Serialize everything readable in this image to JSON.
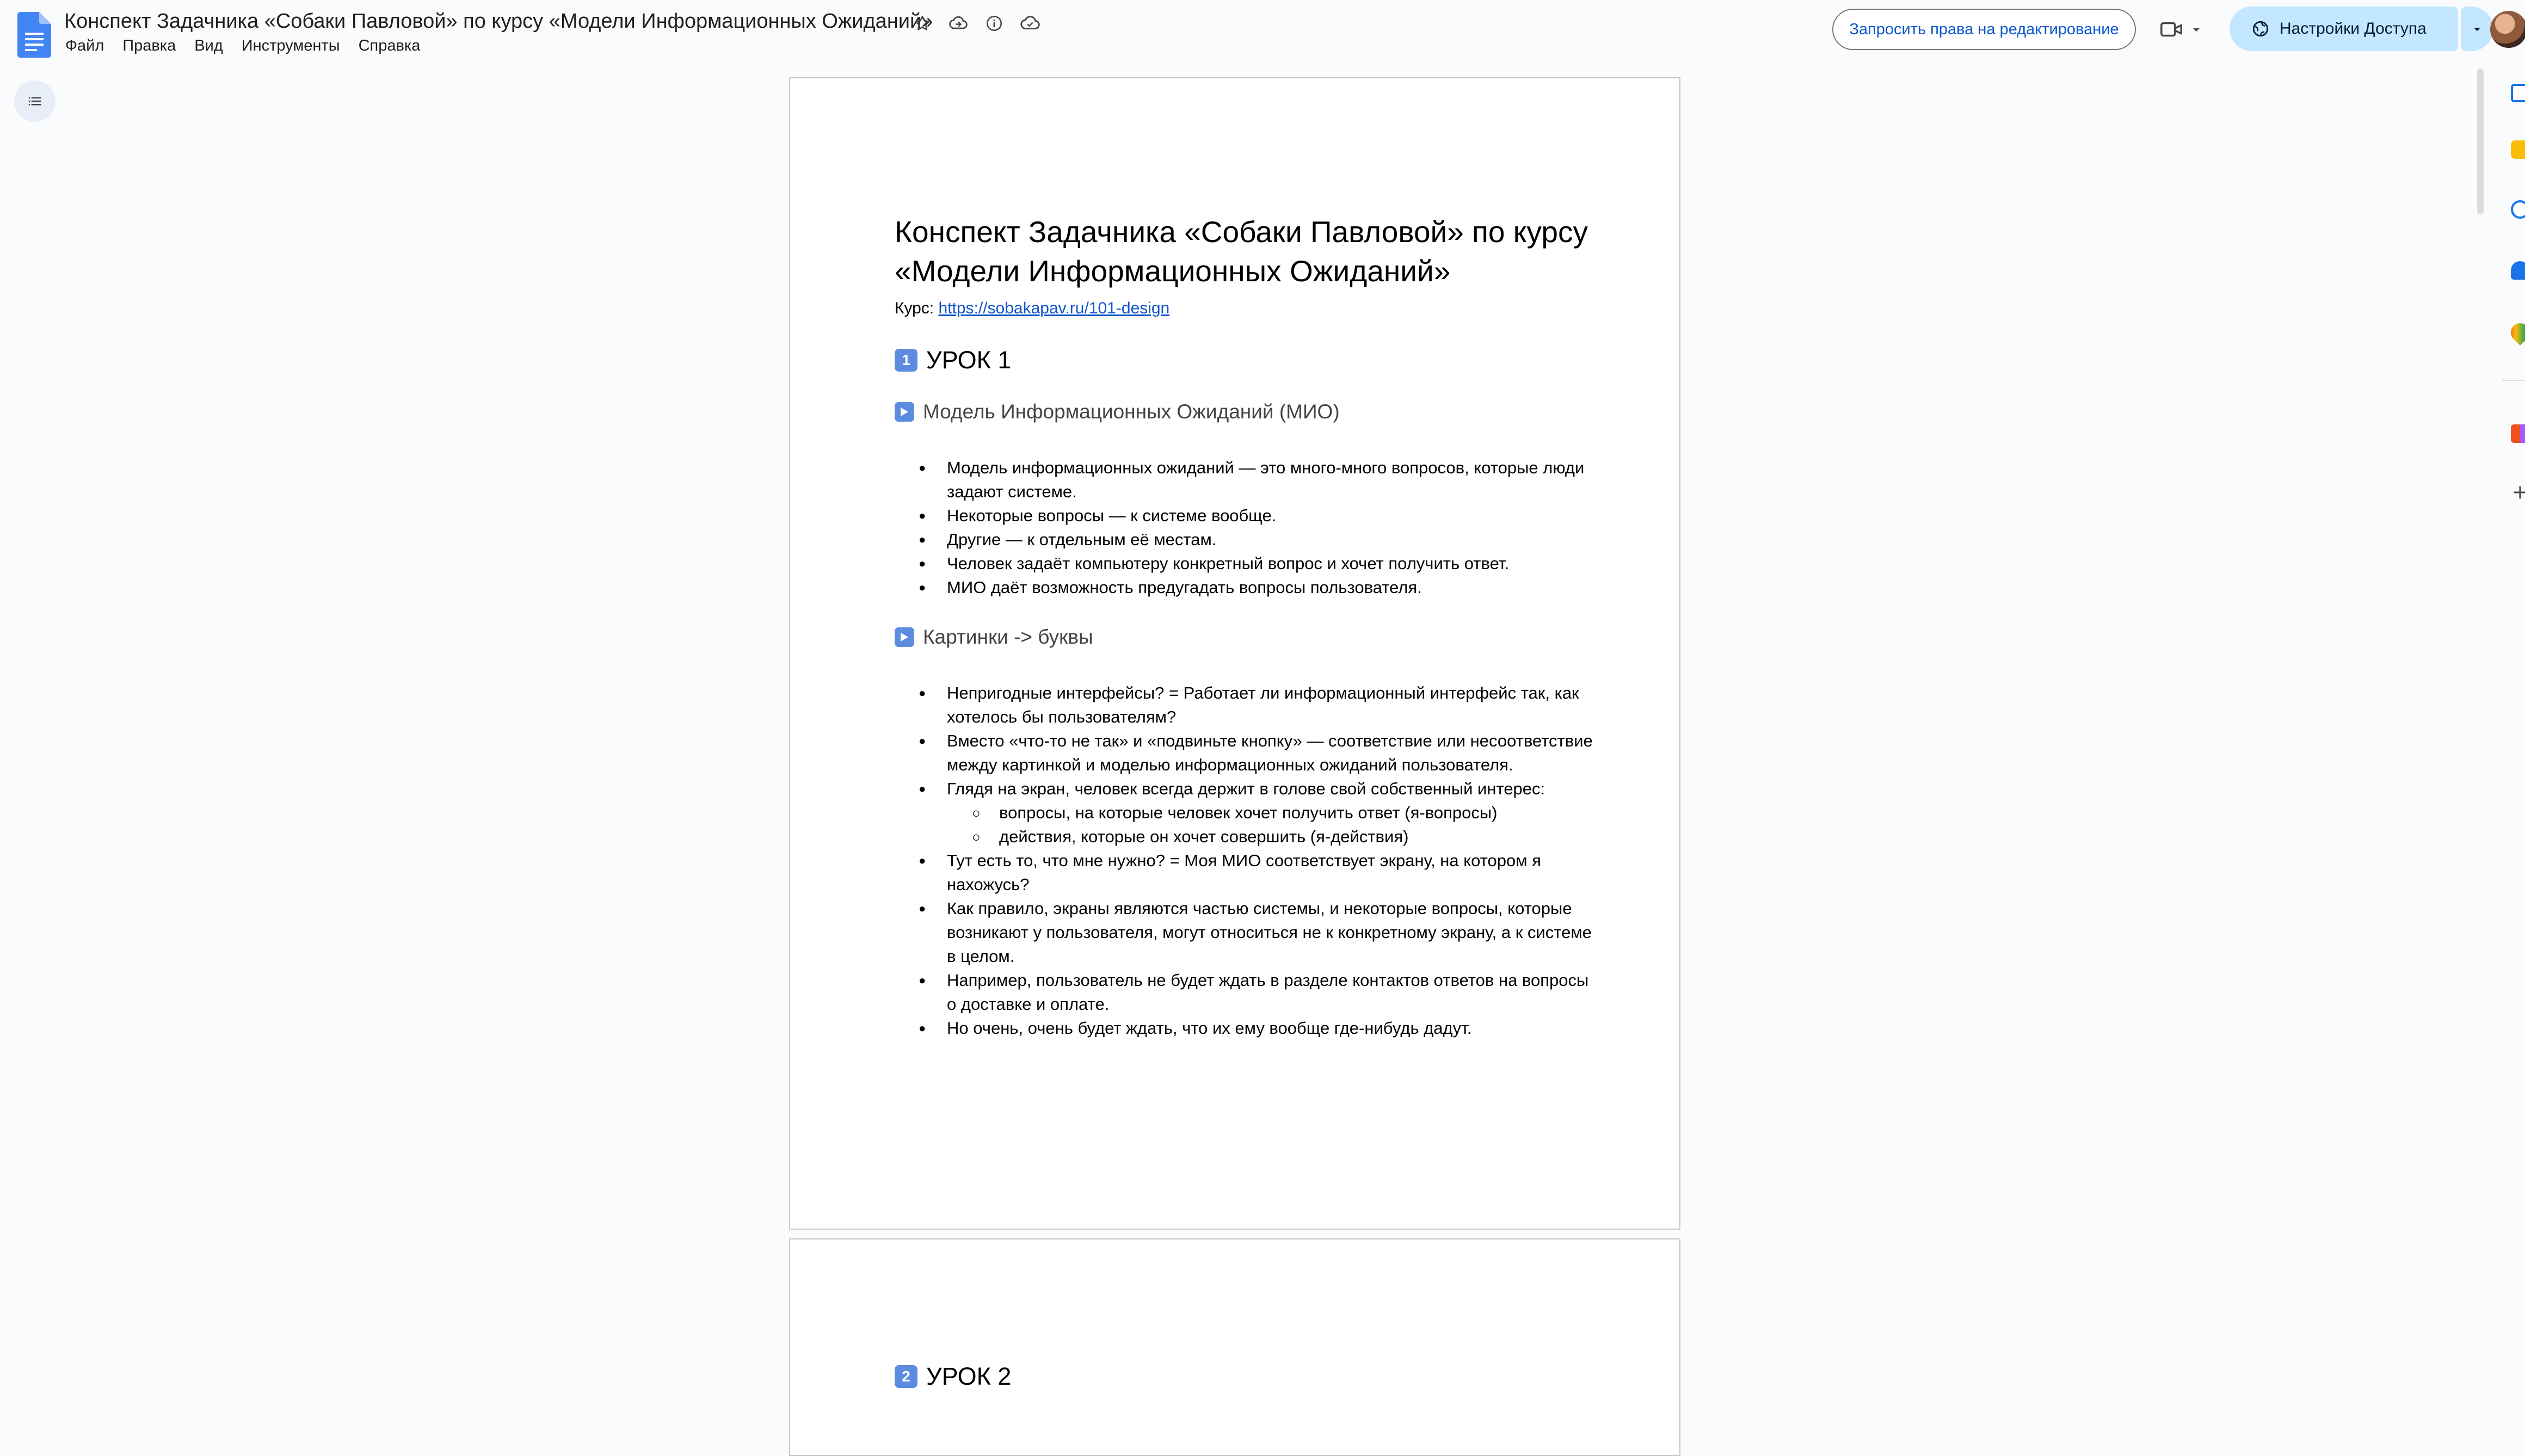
{
  "app": {
    "doc_title": "Конспект Задачника «Собаки Павловой» по курсу «Модели Информационных Ожиданий»",
    "menu": [
      "Файл",
      "Правка",
      "Вид",
      "Инструменты",
      "Справка"
    ],
    "request_edit_label": "Запросить права на редактирование",
    "share_label": "Настройки Доступа",
    "title_icons": [
      "star-icon",
      "move-to-drive-icon",
      "info-icon",
      "cloud-saved-icon"
    ],
    "rail_icons": [
      "calendar-icon",
      "keep-icon",
      "tasks-icon",
      "contacts-icon",
      "maps-icon",
      "figma-icon",
      "add-icon"
    ]
  },
  "doc": {
    "title": "Конспект Задачника «Собаки Павловой» по курсу «Модели Информационных Ожиданий»",
    "course_label": "Курс:",
    "course_link": "https://sobakapav.ru/101-design",
    "lesson1": {
      "badge": "1",
      "heading": "УРОК 1",
      "sections": [
        {
          "heading": "Модель Информационных Ожиданий (МИО)",
          "items": [
            "Модель информационных ожиданий — это много-много вопросов, которые люди задают системе.",
            "Некоторые вопросы — к системе вообще.",
            "Другие — к отдельным её местам.",
            "Человек задаёт компьютеру конкретный вопрос и хочет получить ответ.",
            "МИО даёт возможность предугадать вопросы пользователя."
          ]
        },
        {
          "heading": "Картинки -> буквы",
          "items": [
            "Непригодные интерфейсы? = Работает ли информационный интерфейс так, как хотелось бы пользователям?",
            "Вместо «что-то не так» и «подвиньте кнопку» — соответствие или несоответствие между картинкой и моделью информационных ожиданий пользователя.",
            "Глядя на экран, человек всегда держит в голове свой собственный интерес:",
            "вопросы, на которые человек хочет получить ответ (я-вопросы)",
            "действия, которые он хочет совершить (я-действия)",
            "Тут есть то, что мне нужно? = Моя МИО соответствует экрану, на котором я нахожусь?",
            "Как правило, экраны являются частью системы, и некоторые вопросы, которые возникают у пользователя, могут относиться не к конкретному экрану, а к системе в целом.",
            "Например, пользователь не будет ждать в разделе контактов ответов на вопросы о доставке и оплате.",
            "Но очень, очень будет ждать, что их ему вообще где-нибудь дадут."
          ]
        }
      ]
    },
    "lesson2": {
      "badge": "2",
      "heading": "УРОК 2"
    }
  }
}
